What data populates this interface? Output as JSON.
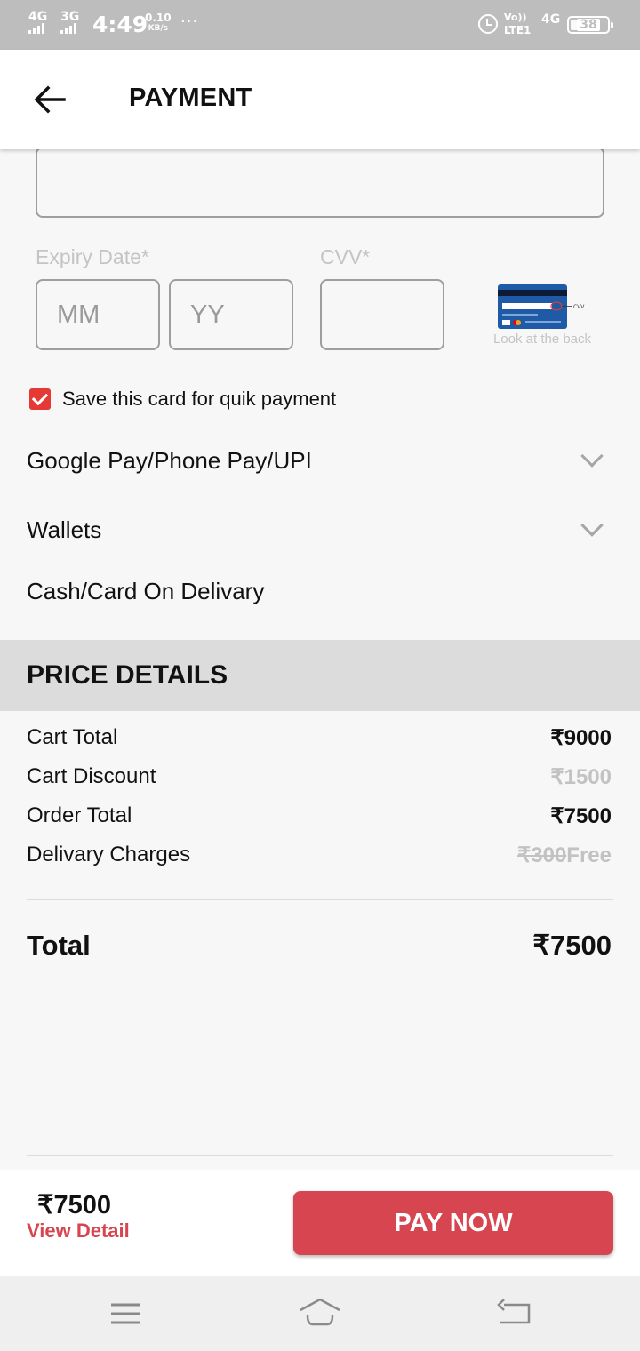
{
  "status_bar": {
    "network_1": "4G",
    "network_2": "3G",
    "time": "4:49",
    "speed_value": "0.10",
    "speed_unit": "KB/s",
    "dots": "···",
    "volte_line1": "Vo))",
    "volte_line2": "LTE1",
    "network_3": "4G",
    "battery": "38"
  },
  "header": {
    "title": "PAYMENT"
  },
  "card_form": {
    "expiry_label": "Expiry Date*",
    "cvv_label": "CVV*",
    "month_placeholder": "MM",
    "year_placeholder": "YY",
    "cvv_hint_label": "Look at the back",
    "cvv_hint_marker": "CVV",
    "save_card_label": "Save this card for quik payment",
    "save_card_checked": true
  },
  "payment_options": [
    {
      "label": "Google Pay/Phone Pay/UPI",
      "expandable": true
    },
    {
      "label": "Wallets",
      "expandable": true
    },
    {
      "label": "Cash/Card On Delivary",
      "expandable": false
    }
  ],
  "price_details": {
    "title": "PRICE DETAILS",
    "rows": [
      {
        "label": "Cart Total",
        "value": "₹9000"
      },
      {
        "label": "Cart Discount",
        "value": "₹1500"
      },
      {
        "label": "Order Total",
        "value": "₹7500"
      },
      {
        "label": "Delivary Charges",
        "original": "₹300",
        "value": "Free"
      }
    ],
    "total_label": "Total",
    "total_value": "₹7500"
  },
  "bottom_bar": {
    "amount": "₹7500",
    "view_detail": "View Detail",
    "pay_now": "PAY NOW"
  },
  "colors": {
    "accent": "#d64550",
    "checkbox": "#e53935",
    "status_bar": "#bdbdbd",
    "section_header": "#dcdcdc",
    "muted_text": "#c2c2c2"
  }
}
